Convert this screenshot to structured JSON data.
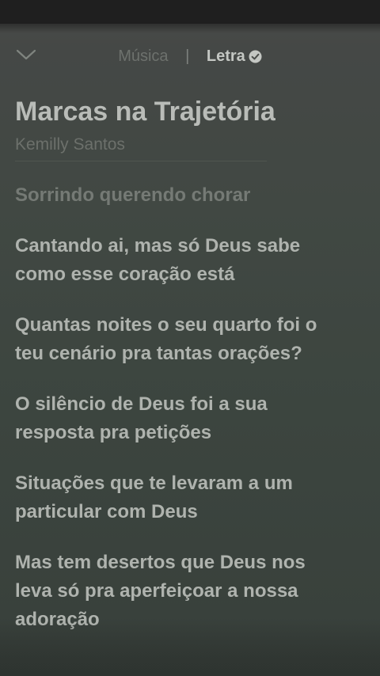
{
  "header": {
    "tabs": [
      {
        "label": "Música",
        "active": false
      },
      {
        "label": "Letra",
        "active": true
      }
    ],
    "separator": "|",
    "collapse_icon": "chevron-down-icon",
    "verified_icon": "check-circle-icon"
  },
  "song": {
    "title": "Marcas na Trajetória",
    "artist": "Kemilly Santos"
  },
  "lyrics": [
    "Sorrindo querendo chorar",
    "Cantando ai, mas só Deus sabe\ncomo esse coração está",
    "Quantas noites o seu quarto foi o\nteu cenário pra tantas orações?",
    "O silêncio de Deus foi a sua\nresposta pra petições",
    "Situações que te levaram a um\nparticular com Deus",
    "Mas tem desertos que Deus nos\nleva só pra aperfeiçoar a nossa\nadoração"
  ],
  "colors": {
    "background": "#414843",
    "text_primary": "#afb3ae",
    "text_muted": "#6c706b"
  }
}
